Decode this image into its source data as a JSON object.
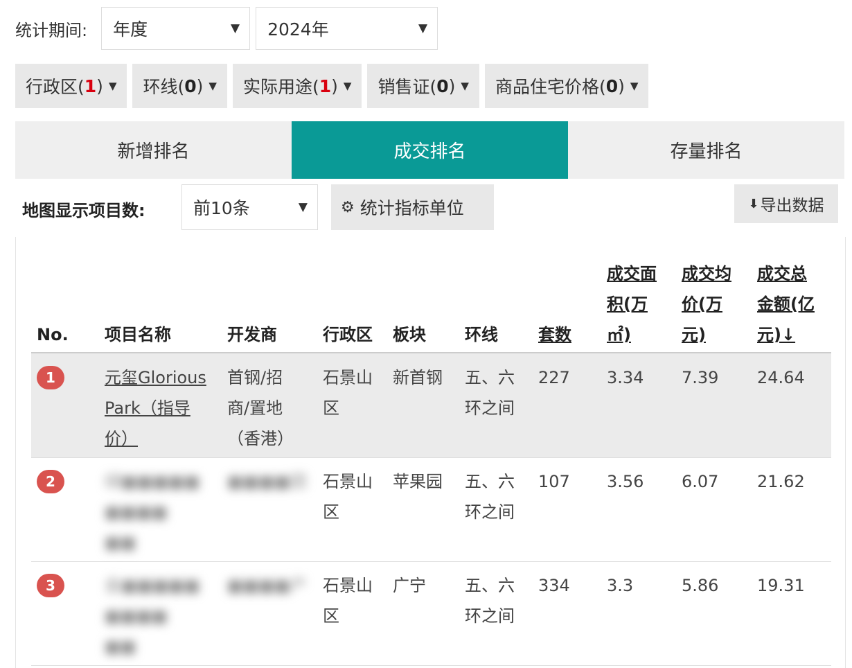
{
  "stats": {
    "period_label": "统计期间:",
    "period_value": "年度",
    "year_value": "2024年"
  },
  "filters": [
    {
      "label": "行政区(",
      "count": "1",
      "close": ")",
      "highlight": true
    },
    {
      "label": "环线(",
      "count": "0",
      "close": ")",
      "highlight": false
    },
    {
      "label": "实际用途(",
      "count": "1",
      "close": ")",
      "highlight": true
    },
    {
      "label": "销售证(",
      "count": "0",
      "close": ")",
      "highlight": false
    },
    {
      "label": "商品住宅价格(",
      "count": "0",
      "close": ")",
      "highlight": false
    }
  ],
  "tabs": [
    {
      "label": "新增排名",
      "active": false
    },
    {
      "label": "成交排名",
      "active": true
    },
    {
      "label": "存量排名",
      "active": false
    }
  ],
  "toolbar": {
    "map_label": "地图显示项目数:",
    "count_value": "前10条",
    "unit_button": "统计指标单位",
    "export_button": "导出数据"
  },
  "table": {
    "headers": {
      "no": "No.",
      "name": "项目名称",
      "developer": "开发商",
      "district": "行政区",
      "block": "板块",
      "ring": "环线",
      "units": "套数",
      "area": [
        "成交面",
        "积(万",
        "㎡)"
      ],
      "avg_price": [
        "成交均",
        "价(万",
        "元)"
      ],
      "total": [
        "成交总",
        "金额(亿",
        "元)↓"
      ]
    },
    "rows": [
      {
        "no": "1",
        "name": [
          "元玺Glorious",
          "Park（指导",
          "价）"
        ],
        "developer": [
          "首钢/招",
          "商/置地",
          "（香港）"
        ],
        "district": [
          "石景山",
          "区"
        ],
        "block": "新首钢",
        "ring": [
          "五、六",
          "环之间"
        ],
        "units": "227",
        "area": "3.34",
        "avg_price": "7.39",
        "total": "24.64"
      },
      {
        "no": "2",
        "name": [
          "绿■■■■■",
          "■■■■",
          "■■"
        ],
        "developer": [
          "■■■■团"
        ],
        "district": [
          "石景山",
          "区"
        ],
        "block": "苹果园",
        "ring": [
          "五、六",
          "环之间"
        ],
        "units": "107",
        "area": "3.56",
        "avg_price": "6.07",
        "total": "21.62"
      },
      {
        "no": "3",
        "name": [
          "金■■■■■",
          "■■■■",
          "■■"
        ],
        "developer": [
          "■■■■产"
        ],
        "district": [
          "石景山",
          "区"
        ],
        "block": "广宁",
        "ring": [
          "五、六",
          "环之间"
        ],
        "units": "334",
        "area": "3.3",
        "avg_price": "5.86",
        "total": "19.31"
      }
    ]
  }
}
